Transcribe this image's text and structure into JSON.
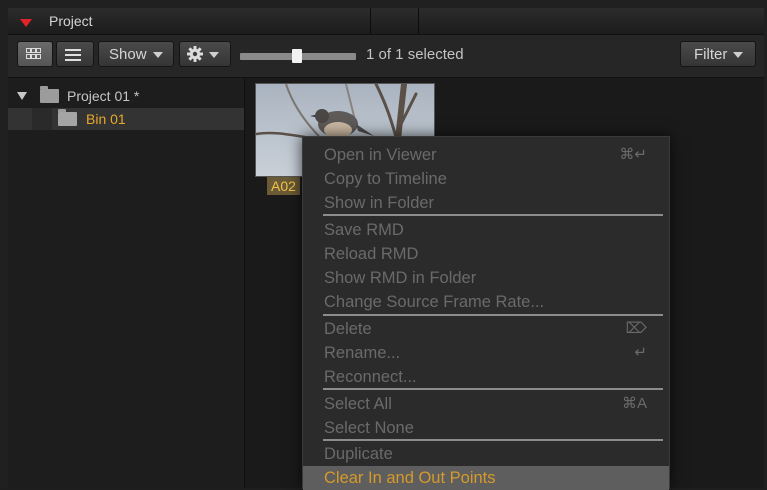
{
  "panel": {
    "title": "Project"
  },
  "toolbar": {
    "show_label": "Show",
    "filter_label": "Filter",
    "selection_status": "1 of 1 selected",
    "thumbnail_size_level": 0.45
  },
  "tree": {
    "project_label": "Project 01 *",
    "bin_label": "Bin 01"
  },
  "browser": {
    "clip_label": "A02"
  },
  "menu": {
    "items": [
      {
        "label": "Open in Viewer",
        "shortcut": "⌘↵"
      },
      {
        "label": "Copy to Timeline",
        "shortcut": ""
      },
      {
        "label": "Show in Folder",
        "shortcut": ""
      },
      {
        "label": "Save RMD",
        "shortcut": ""
      },
      {
        "label": "Reload RMD",
        "shortcut": ""
      },
      {
        "label": "Show RMD in Folder",
        "shortcut": ""
      },
      {
        "label": "Change Source Frame Rate...",
        "shortcut": ""
      },
      {
        "label": "Delete",
        "shortcut": "⌦"
      },
      {
        "label": "Rename...",
        "shortcut": "↵"
      },
      {
        "label": "Reconnect...",
        "shortcut": ""
      },
      {
        "label": "Select All",
        "shortcut": "⌘A"
      },
      {
        "label": "Select None",
        "shortcut": ""
      },
      {
        "label": "Duplicate",
        "shortcut": ""
      },
      {
        "label": "Clear In and Out Points",
        "shortcut": ""
      }
    ]
  },
  "colors": {
    "accent_red": "#e0242a",
    "selection_orange": "#e8a82e",
    "highlight_text": "#d59a2a"
  }
}
